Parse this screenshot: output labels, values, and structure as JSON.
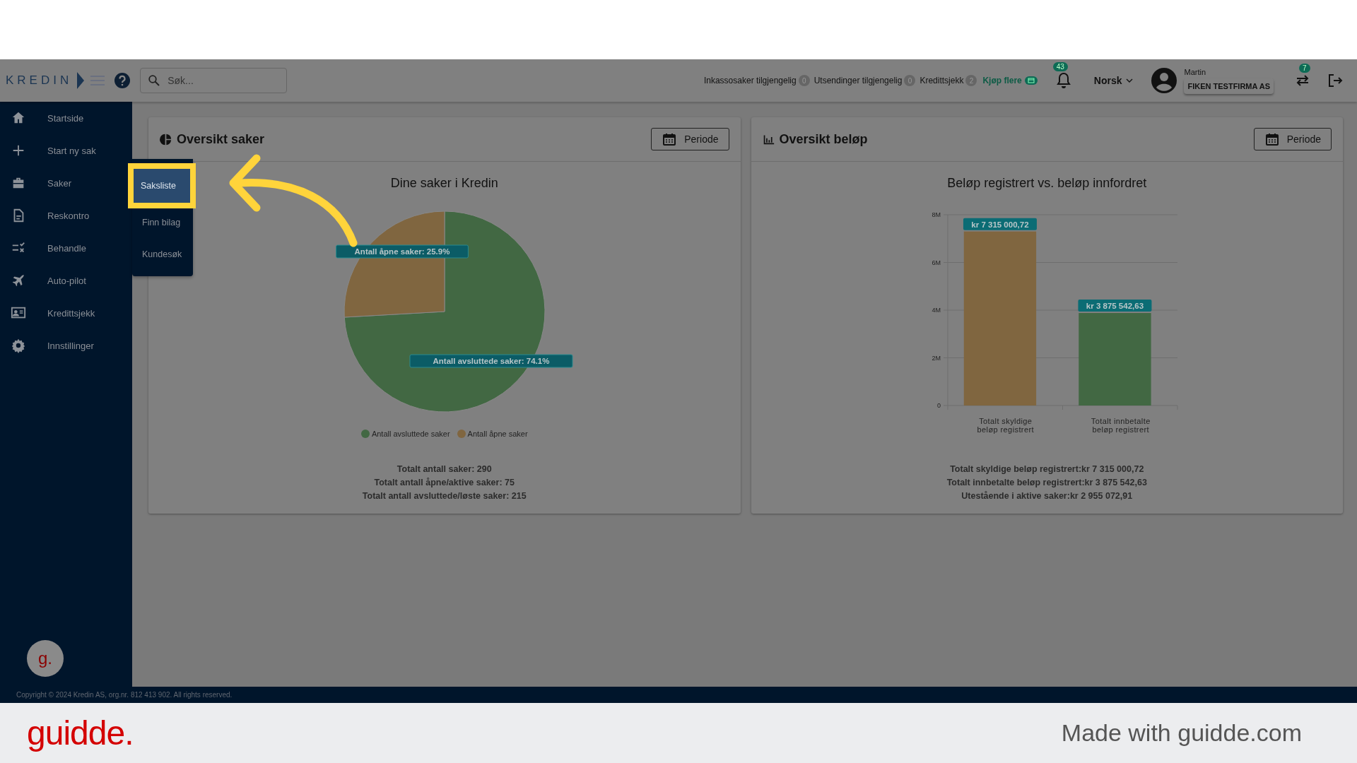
{
  "header": {
    "logo": "KREDIN",
    "search": {
      "placeholder": "Søk..."
    },
    "counters": [
      {
        "label": "Inkassosaker tilgjengelig",
        "count": "0"
      },
      {
        "label": "Utsendinger tilgjengelig",
        "count": "0"
      },
      {
        "label": "Kredittsjekk",
        "count": "2"
      }
    ],
    "buy_link": "Kjøp flere",
    "notifications": "43",
    "language": "Norsk",
    "user": {
      "name": "Martin",
      "company": "FIKEN TESTFIRMA AS"
    },
    "switch_badge": "7"
  },
  "sidebar": {
    "items": [
      {
        "label": "Startside"
      },
      {
        "label": "Start ny sak"
      },
      {
        "label": "Saker"
      },
      {
        "label": "Reskontro"
      },
      {
        "label": "Behandle"
      },
      {
        "label": "Auto-pilot"
      },
      {
        "label": "Kredittsjekk"
      },
      {
        "label": "Innstillinger"
      }
    ],
    "submenu": [
      {
        "label": "Saksliste",
        "selected": true
      },
      {
        "label": "Finn bilag",
        "selected": false
      },
      {
        "label": "Kundesøk",
        "selected": false
      }
    ],
    "helper_bubble": "g."
  },
  "cards": [
    {
      "title": "Oversikt saker",
      "button": "Periode",
      "chart_data": {
        "type": "pie",
        "title": "Dine saker i Kredin",
        "categories": [
          "Antall avsluttede saker",
          "Antall åpne saker"
        ],
        "values": [
          74.1,
          25.9
        ],
        "colors": [
          "#426843",
          "#806640"
        ],
        "value_labels": [
          "Antall avsluttede saker: 74.1%",
          "Antall åpne saker: 25.9%"
        ]
      },
      "stats": [
        "Totalt antall saker: 290",
        "Totalt antall åpne/aktive saker: 75",
        "Totalt antall avsluttede/løste saker: 215"
      ]
    },
    {
      "title": "Oversikt beløp",
      "button": "Periode",
      "chart_data": {
        "type": "bar",
        "title": "Beløp registrert vs. beløp innfordret",
        "categories": [
          "Totalt skyldige beløp registrert",
          "Totalt innbetalte beløp registrert"
        ],
        "grid": true,
        "values": [
          7300000,
          3880000
        ],
        "colors": [
          "#806640",
          "#426843"
        ],
        "ylim": [
          0,
          8000000
        ],
        "yticks": [
          {
            "value": 0,
            "label": "0"
          },
          {
            "value": 2000000,
            "label": "2M"
          },
          {
            "value": 4000000,
            "label": "4M"
          },
          {
            "value": 6000000,
            "label": "6M"
          },
          {
            "value": 8000000,
            "label": "8M"
          }
        ],
        "value_labels": [
          "kr 7 315 000,72",
          "kr 3 875 542,63"
        ]
      },
      "stats": [
        "Totalt skyldige beløp registrert:kr 7 315 000,72",
        "Totalt innbetalte beløp registrert:kr 3 875 542,63",
        "Utestående i aktive saker:kr 2 955 072,91"
      ]
    }
  ],
  "footer": "Copyright © 2024 Kredin AS, org.nr. 812 413 902. All rights reserved.",
  "branding": {
    "logo": "guidde.",
    "tagline": "Made with guidde.com"
  }
}
